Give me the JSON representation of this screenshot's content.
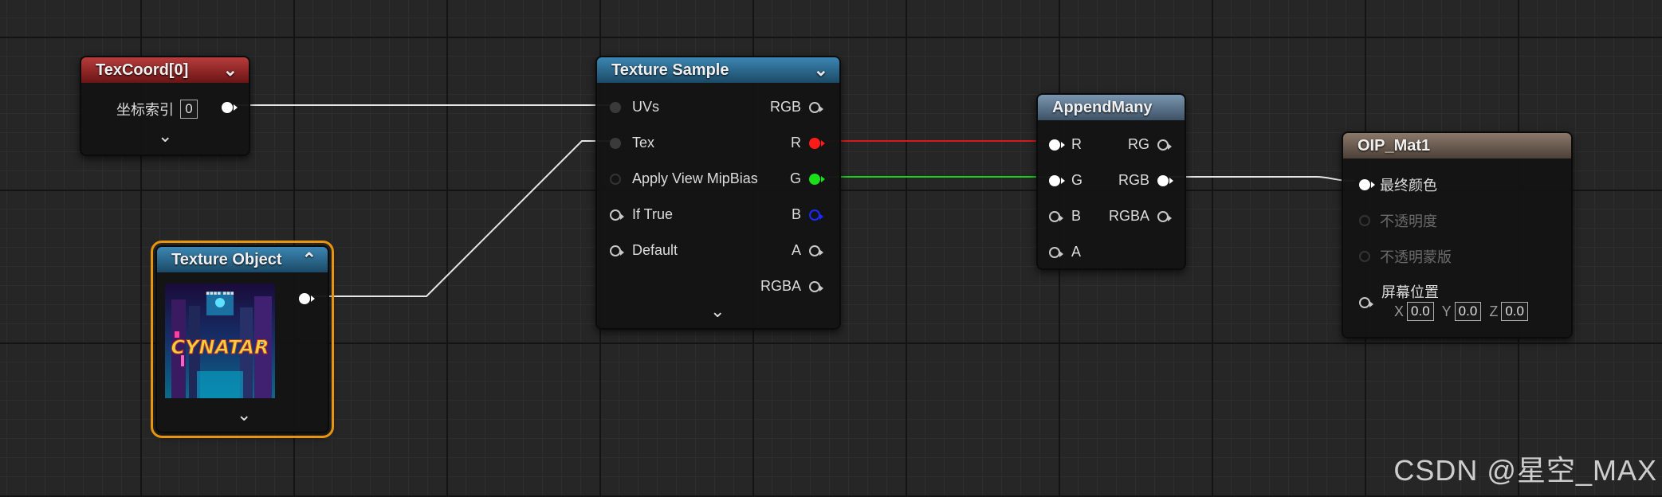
{
  "nodes": {
    "texcoord": {
      "title": "TexCoord[0]",
      "property_label": "坐标索引",
      "property_value": "0",
      "expand_icon": "chevron-down"
    },
    "texture_object": {
      "title": "Texture Object",
      "thumbnail_text": "CYNATAR",
      "collapse_icon": "chevron-up",
      "expand_icon": "chevron-down"
    },
    "texture_sample": {
      "title": "Texture Sample",
      "inputs": [
        "UVs",
        "Tex",
        "Apply View MipBias",
        "If True",
        "Default"
      ],
      "outputs": [
        "RGB",
        "R",
        "G",
        "B",
        "A",
        "RGBA"
      ],
      "pin_colors": {
        "R": "#ff1a1a",
        "G": "#1ae01a",
        "B": "#1a2aff"
      }
    },
    "append_many": {
      "title": "AppendMany",
      "inputs": [
        "R",
        "G",
        "B",
        "A"
      ],
      "outputs": [
        "RG",
        "RGB",
        "RGBA"
      ]
    },
    "material": {
      "title": "OIP_Mat1",
      "inputs": [
        "最终颜色",
        "不透明度",
        "不透明蒙版",
        "屏幕位置"
      ],
      "screen_pos": {
        "x_label": "X",
        "x_value": "0.0",
        "y_label": "Y",
        "y_value": "0.0",
        "z_label": "Z",
        "z_value": "0.0"
      }
    }
  },
  "watermark": "CSDN @星空_MAX"
}
